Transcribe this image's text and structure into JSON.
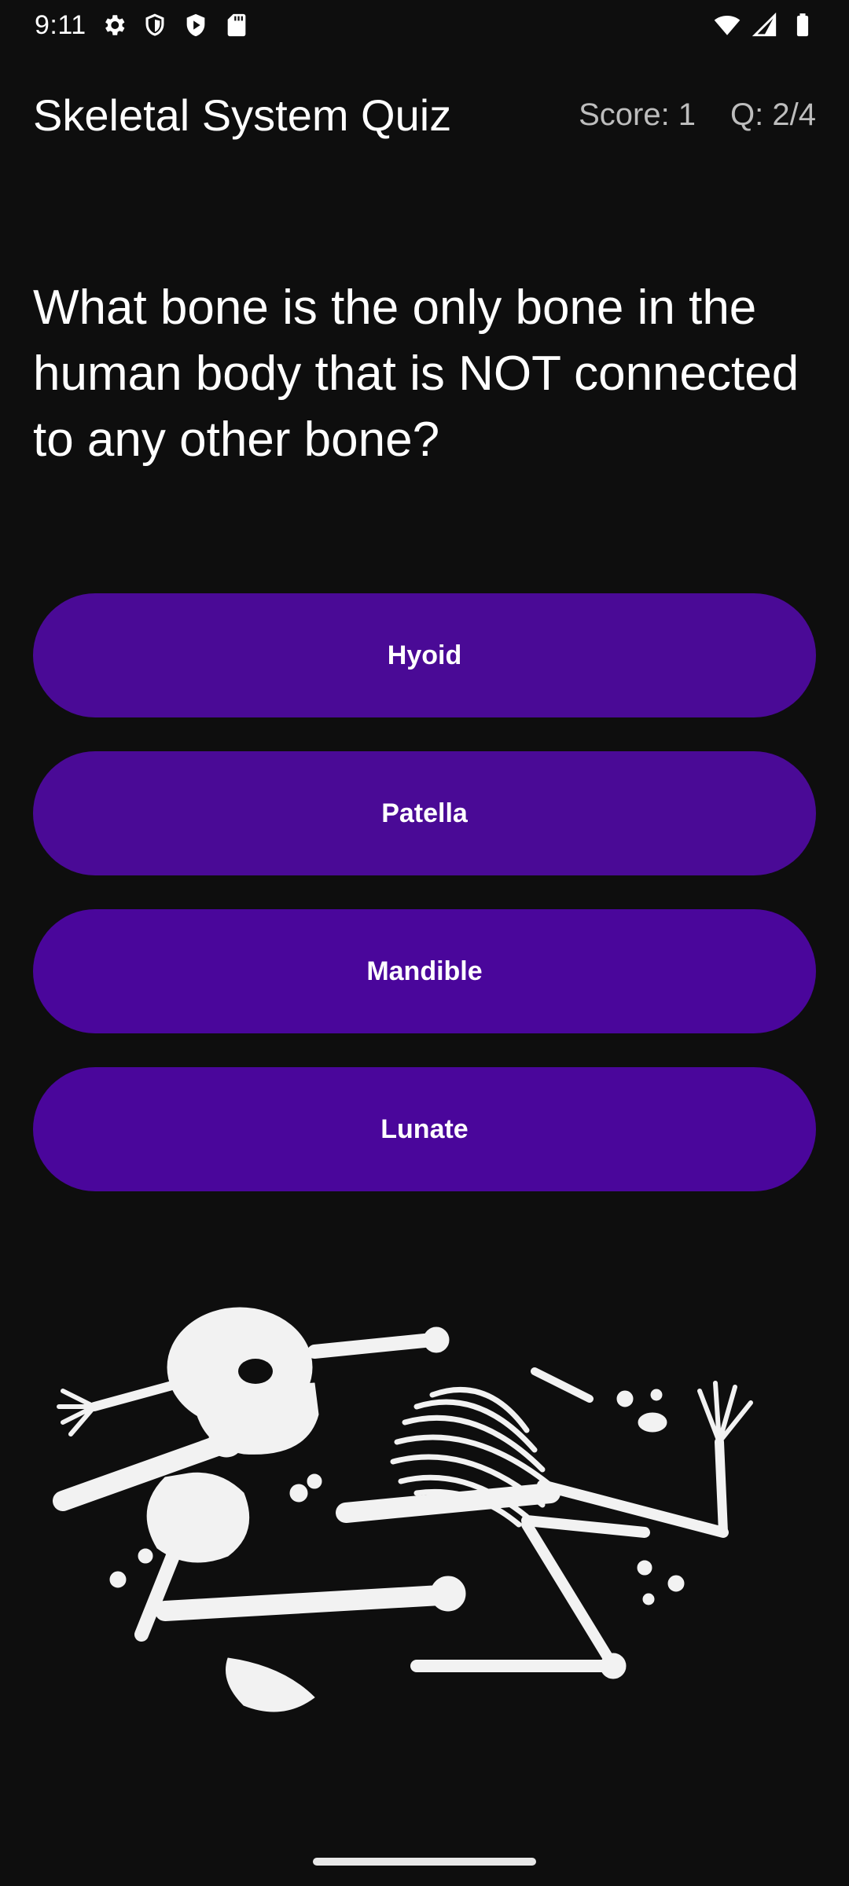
{
  "status_bar": {
    "time": "9:11",
    "icons": [
      "gear-icon",
      "shield-icon",
      "play-shield-icon",
      "sd-card-icon",
      "wifi-icon",
      "cell-signal-icon",
      "battery-icon"
    ]
  },
  "header": {
    "title": "Skeletal System Quiz",
    "score": "Score: 1",
    "question_counter": "Q: 2/4"
  },
  "question": {
    "text": "What bone is the only bone in the human body that is NOT connected to any other bone?"
  },
  "answers": [
    {
      "label": "Hyoid",
      "color": "#4a0a96"
    },
    {
      "label": "Patella",
      "color": "#4a0a96"
    },
    {
      "label": "Mandible",
      "color": "#4a069b"
    },
    {
      "label": "Lunate",
      "color": "#4a069b"
    }
  ],
  "illustration": {
    "icon": "skeleton-illustration"
  },
  "colors": {
    "background": "#0e0e0e",
    "button": "#4a0a96",
    "text_primary": "#ffffff",
    "text_secondary": "#bdbdbd"
  }
}
